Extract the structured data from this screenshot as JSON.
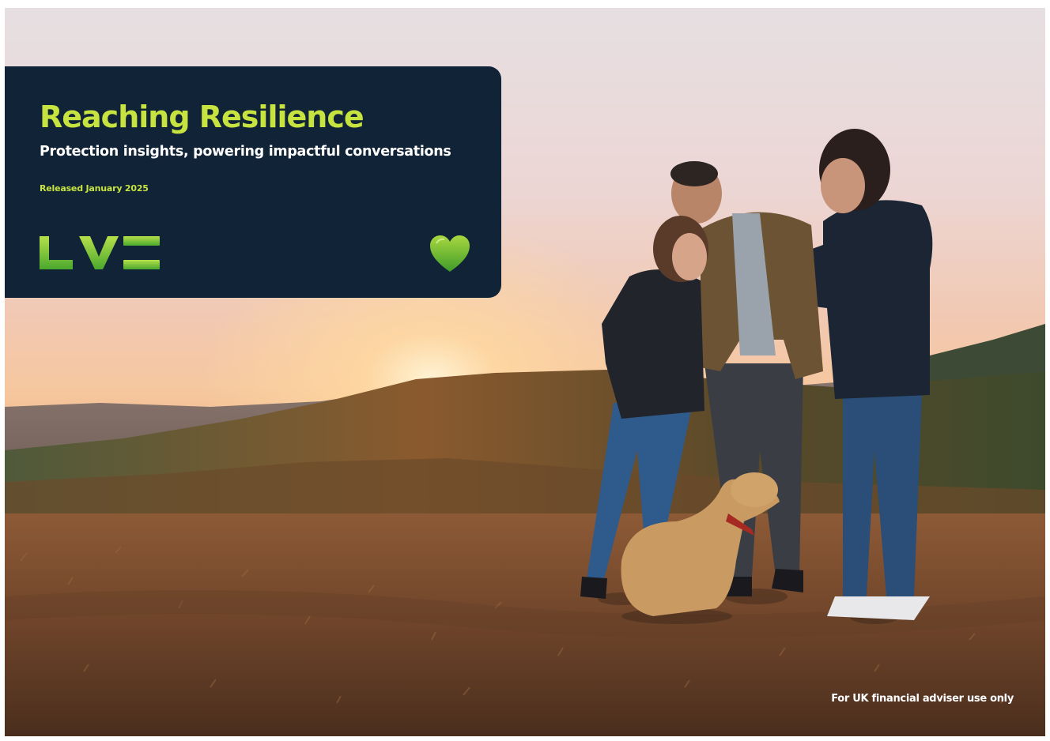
{
  "cover": {
    "title": "Reaching Resilience",
    "subtitle": "Protection insights, powering impactful conversations",
    "release_date": "Released January 2025",
    "footer_note": "For UK financial adviser use only"
  },
  "brand": {
    "logo": "LV=",
    "accent_color": "#c7e33f",
    "card_color": "#112337",
    "heart_icon": "green-heart-icon"
  }
}
